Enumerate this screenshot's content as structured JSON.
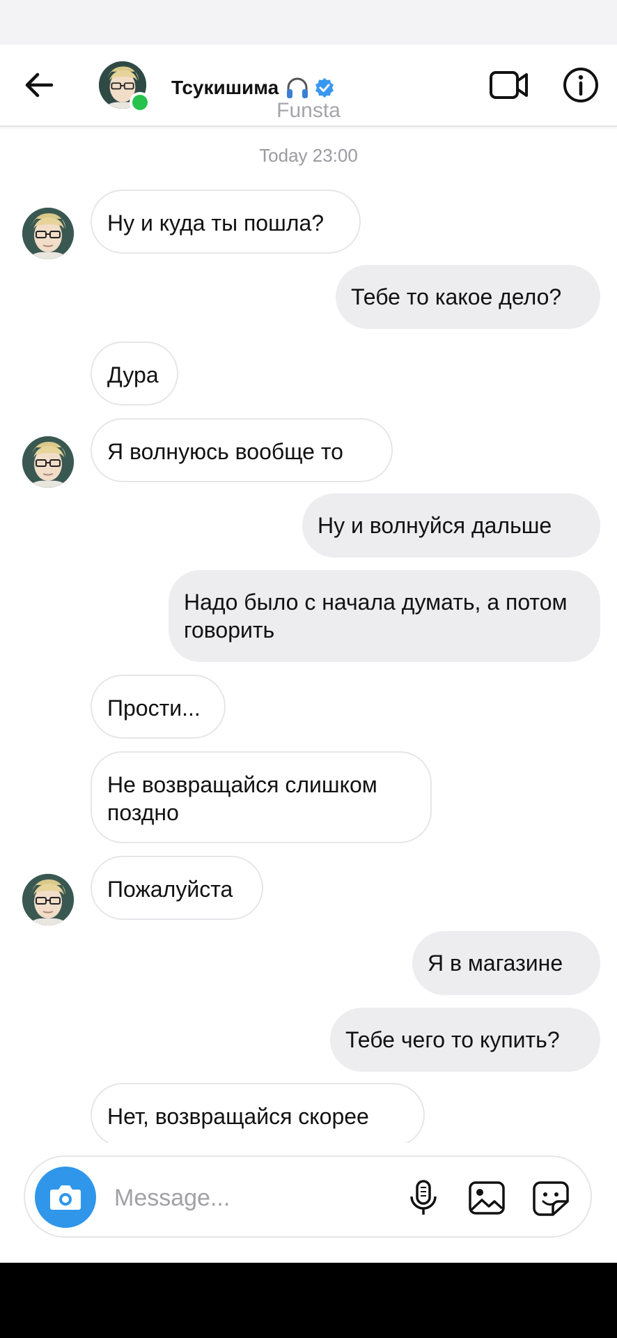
{
  "header": {
    "title": "Тсукишима",
    "subtitle": "Funsta",
    "icons": [
      "back-arrow-icon",
      "headphones-icon",
      "verified-badge-icon",
      "video-call-icon",
      "info-icon"
    ]
  },
  "conversation": {
    "timestamp": "Today 23:00",
    "messages": [
      {
        "side": "in",
        "text": "Ну и куда ты пошла?"
      },
      {
        "side": "out",
        "text": "Тебе то какое дело?"
      },
      {
        "side": "in",
        "text": "Дура"
      },
      {
        "side": "in",
        "text": "Я волнуюсь вообще то"
      },
      {
        "side": "out",
        "text": "Ну и волнуйся дальше"
      },
      {
        "side": "out",
        "text": "Надо было с начала думать, а потом говорить"
      },
      {
        "side": "in",
        "text": "Прости..."
      },
      {
        "side": "in",
        "text": "Не возвращайся слишком поздно"
      },
      {
        "side": "in",
        "text": "Пожалуйста"
      },
      {
        "side": "out",
        "text": "Я в магазине"
      },
      {
        "side": "out",
        "text": "Тебе чего то купить?"
      },
      {
        "side": "in",
        "text": "Нет, возвращайся скорее"
      }
    ]
  },
  "composer": {
    "placeholder": "Message...",
    "icons": [
      "camera-icon",
      "microphone-icon",
      "gallery-icon",
      "sticker-icon"
    ]
  },
  "colors": {
    "accent": "#2f96ea",
    "verified": "#3897f0",
    "online": "#27c24c",
    "outgoing_bubble": "#ededf0",
    "incoming_border": "#e6e6ea"
  }
}
